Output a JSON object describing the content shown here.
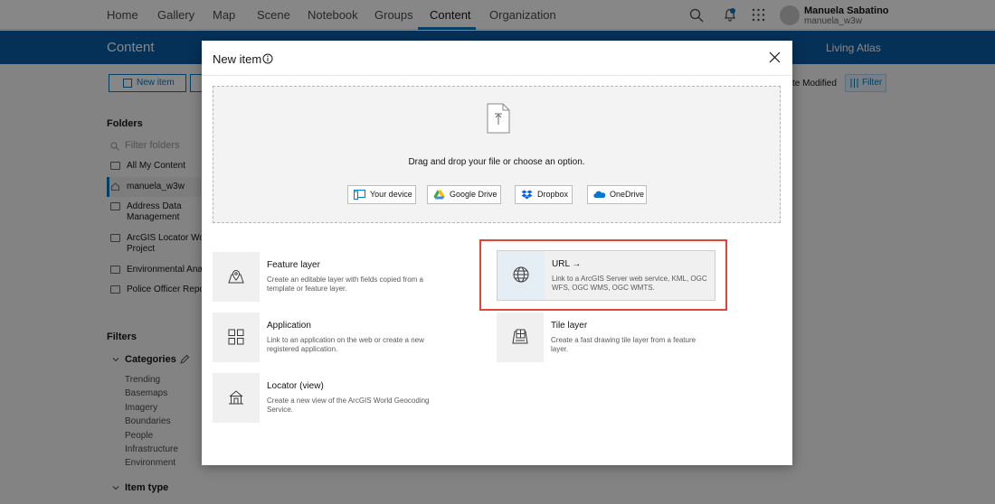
{
  "topnav": {
    "items": [
      "Home",
      "Gallery",
      "Map",
      "Scene",
      "Notebook",
      "Groups",
      "Content",
      "Organization"
    ],
    "active": "Content",
    "user_name": "Manuela Sabatino",
    "user_handle": "manuela_w3w"
  },
  "header": {
    "title": "Content",
    "living_atlas": "Living Atlas"
  },
  "toolbar": {
    "new_item_label": "New item",
    "sort_label": "te Modified",
    "filter_label": "Filter"
  },
  "sidebar": {
    "folders_heading": "Folders",
    "folder_search_placeholder": "Filter folders",
    "folders": [
      "All My Content",
      "manuela_w3w",
      "Address Data",
      "Management",
      "ArcGIS Locator Workf",
      "Project",
      "Environmental Analy",
      "Police Officer Reporte"
    ],
    "filters_heading": "Filters",
    "categories_label": "Categories",
    "categories": [
      "Trending",
      "Basemaps",
      "Imagery",
      "Boundaries",
      "People",
      "Infrastructure",
      "Environment"
    ],
    "item_type_label": "Item type"
  },
  "modal": {
    "title": "New item",
    "drop_text": "Drag and drop your file or choose an option.",
    "sources": [
      "Your device",
      "Google Drive",
      "Dropbox",
      "OneDrive"
    ],
    "options": {
      "feature_layer": {
        "title": "Feature layer",
        "desc": "Create an editable layer with fields copied from a template or feature layer."
      },
      "url": {
        "title": "URL →",
        "desc": "Link to a ArcGIS Server web service, KML, OGC WFS, OGC WMS, OGC WMTS."
      },
      "application": {
        "title": "Application",
        "desc": "Link to an application on the web or create a new registered application."
      },
      "tile_layer": {
        "title": "Tile layer",
        "desc": "Create a fast drawing tile layer from a feature layer."
      },
      "locator": {
        "title": "Locator (view)",
        "desc": "Create a new view of the ArcGIS World Geocoding Service."
      }
    }
  },
  "colors": {
    "brand_blue": "#0a5ea9",
    "accent": "#007ac2",
    "highlight": "#e0453a"
  }
}
